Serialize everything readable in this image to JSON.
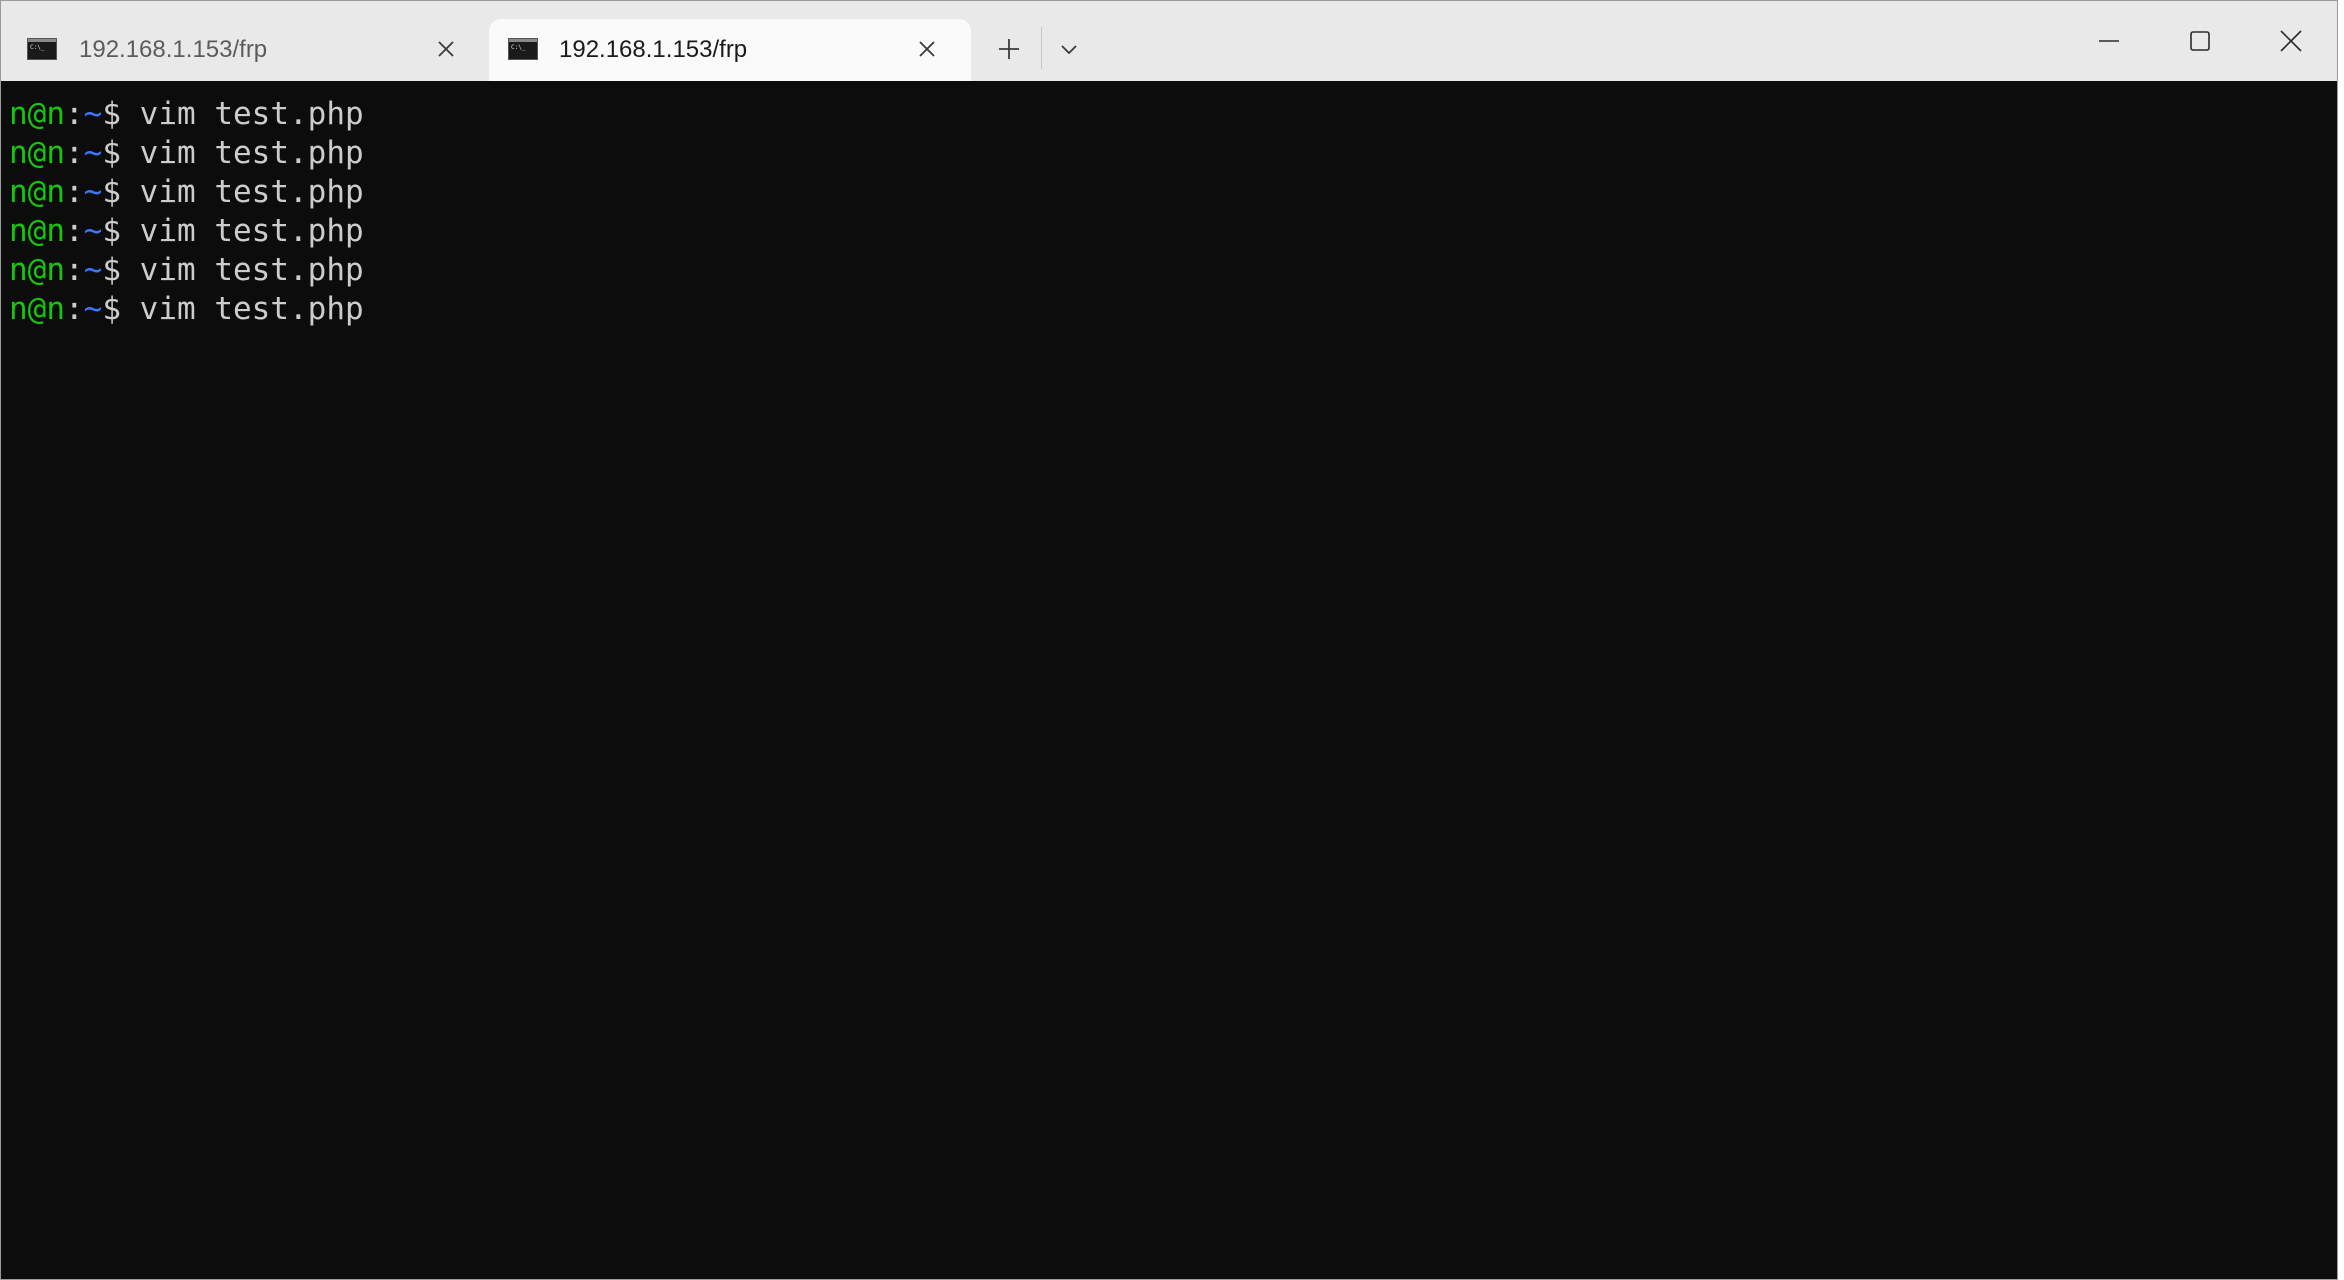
{
  "tabs": [
    {
      "title": "192.168.1.153/frp",
      "active": false,
      "icon": "terminal-icon"
    },
    {
      "title": "192.168.1.153/frp",
      "active": true,
      "icon": "terminal-icon"
    }
  ],
  "toolbar": {
    "new_tab_icon": "plus-icon",
    "dropdown_icon": "chevron-down-icon"
  },
  "window_controls": {
    "minimize_icon": "minimize-icon",
    "maximize_icon": "maximize-icon",
    "close_icon": "close-icon"
  },
  "terminal": {
    "lines": [
      {
        "user": "n@n",
        "colon": ":",
        "path": "~",
        "dollar": "$",
        "command": " vim test.php"
      },
      {
        "user": "n@n",
        "colon": ":",
        "path": "~",
        "dollar": "$",
        "command": " vim test.php"
      },
      {
        "user": "n@n",
        "colon": ":",
        "path": "~",
        "dollar": "$",
        "command": " vim test.php"
      },
      {
        "user": "n@n",
        "colon": ":",
        "path": "~",
        "dollar": "$",
        "command": " vim test.php"
      },
      {
        "user": "n@n",
        "colon": ":",
        "path": "~",
        "dollar": "$",
        "command": " vim test.php"
      },
      {
        "user": "n@n",
        "colon": ":",
        "path": "~",
        "dollar": "$",
        "command": " vim test.php"
      }
    ]
  },
  "colors": {
    "terminal_bg": "#0c0c0c",
    "prompt_user": "#16c60c",
    "prompt_path": "#3b78ff",
    "text": "#cccccc",
    "titlebar_bg": "#e9e9e9",
    "active_tab_bg": "#fafafa"
  }
}
